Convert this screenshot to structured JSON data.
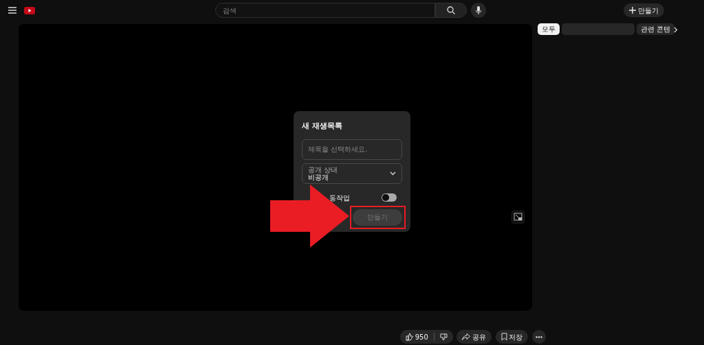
{
  "header": {
    "search": {
      "placeholder": "검색"
    },
    "create_button": "만들기"
  },
  "chips": [
    {
      "label": "모두",
      "selected": true
    },
    {
      "label": "관련 콘텐",
      "selected": false
    }
  ],
  "dialog": {
    "title": "새 재생목록",
    "title_field": {
      "placeholder": "제목을 선택하세요."
    },
    "visibility": {
      "label": "공개 상태",
      "value": "비공개"
    },
    "collab": {
      "label": "동작업",
      "on": false
    },
    "create_button": {
      "label": "만들기",
      "disabled": true
    }
  },
  "actions": {
    "likes": "950",
    "share": "공유",
    "save": "저장"
  }
}
